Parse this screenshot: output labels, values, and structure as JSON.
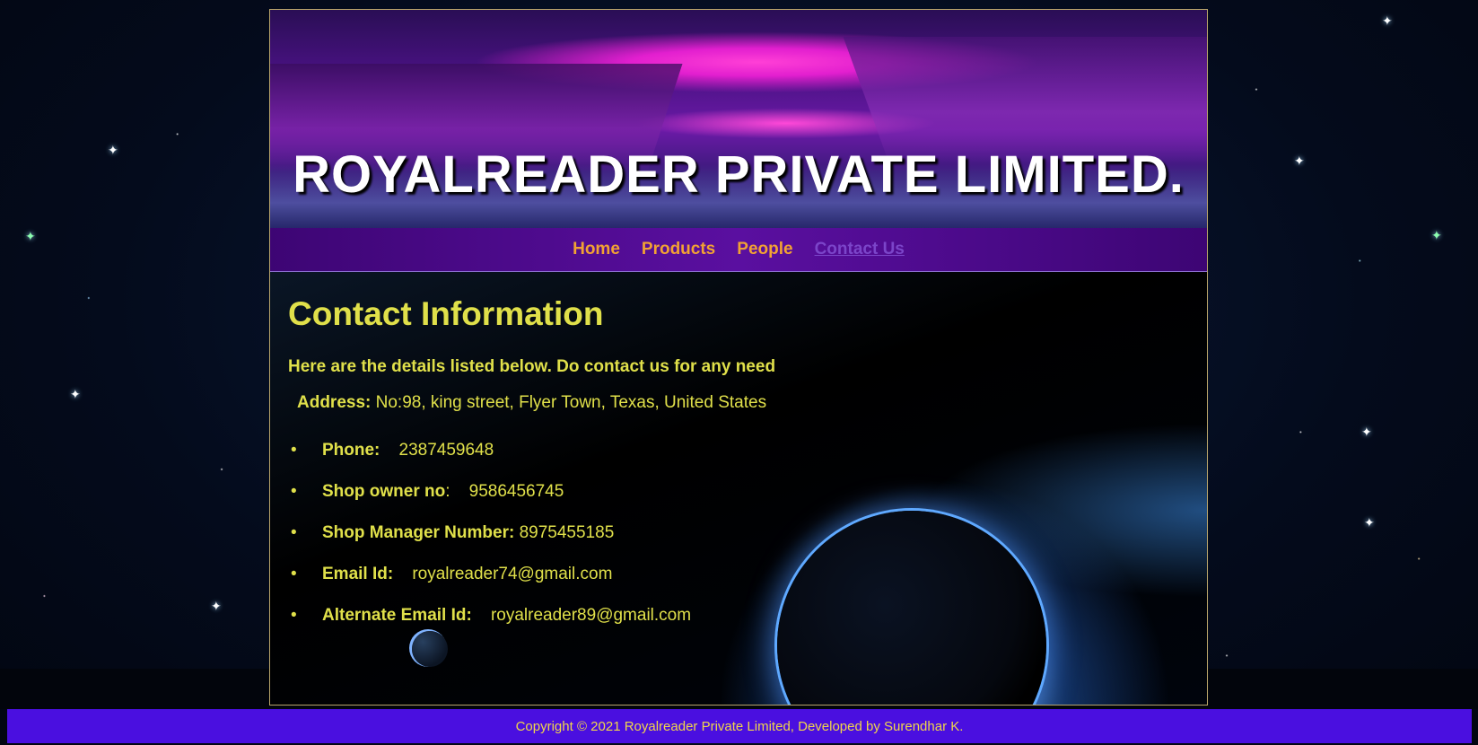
{
  "banner": {
    "title": "ROYALREADER PRIVATE LIMITED."
  },
  "nav": {
    "items": [
      {
        "label": "Home",
        "active": false
      },
      {
        "label": "Products",
        "active": false
      },
      {
        "label": "People",
        "active": false
      },
      {
        "label": "Contact Us",
        "active": true
      }
    ]
  },
  "contact": {
    "heading": "Contact Information",
    "intro": "Here are the details listed below. Do contact us for any need",
    "address_label": "Address:",
    "address_value": " No:98, king street, Flyer Town, Texas, United States",
    "details": [
      {
        "label": "Phone:",
        "value": "2387459648"
      },
      {
        "label": "Shop owner no",
        "sep": ":",
        "value": "9586456745"
      },
      {
        "label": "Shop Manager Number:",
        "value": "8975455185"
      },
      {
        "label": "Email Id:",
        "value": "royalreader74@gmail.com"
      },
      {
        "label": "Alternate Email Id:",
        "value": "royalreader89@gmail.com"
      }
    ],
    "bullet": "•"
  },
  "footer": {
    "text": "Copyright © 2021 Royalreader Private Limited, Developed by Surendhar K."
  },
  "colors": {
    "accent_yellow": "#e0e04a",
    "nav_orange": "#f2a233",
    "nav_active": "#7b45c9",
    "footer_bg": "#4a0fe0"
  }
}
